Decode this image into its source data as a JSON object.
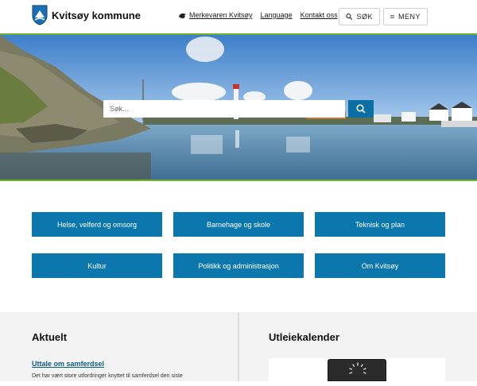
{
  "header": {
    "logo_text": "Kvitsøy kommune",
    "links": [
      {
        "label": "Merkevaren Kvitsøy",
        "icon": "seal-icon"
      },
      {
        "label": "Language"
      },
      {
        "label": "Kontakt oss"
      }
    ],
    "search_label": "SØK",
    "menu_label": "MENY"
  },
  "hero": {
    "search_placeholder": "Søk..."
  },
  "tiles": [
    "Helse, velferd og omsorg",
    "Barnehage og skole",
    "Teknisk og plan",
    "Kultur",
    "Politikk og administrasjon",
    "Om Kvitsøy"
  ],
  "news": {
    "heading": "Aktuelt",
    "item_title": "Uttale om samferdsel",
    "item_excerpt": "Det har vært store utfordringer knyttet til samferdsel den siste"
  },
  "calendar": {
    "heading": "Utleiekalender"
  },
  "colors": {
    "brand_blue": "#0c77ad",
    "accent_green": "#6fae2f"
  }
}
